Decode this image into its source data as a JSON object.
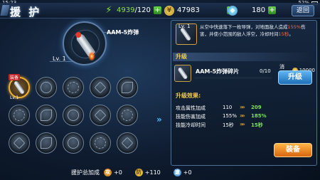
{
  "status_bar": {
    "time": "15:23",
    "battery": "52%"
  },
  "header": {
    "title": "援 护",
    "energy": {
      "current": "4939",
      "max": "/120"
    },
    "coins": "47983",
    "gems": "180",
    "return_label": "返回"
  },
  "main_skill": {
    "name": "AAM-5炸弹",
    "level": "Lv. 1"
  },
  "skill_grid": {
    "slots": [
      {
        "badge": "装备",
        "level": "Lv.1"
      }
    ]
  },
  "bottom": {
    "label": "援护总加成",
    "atk_symbol": "攻",
    "def_symbol": "防",
    "spd_symbol": "速",
    "atk_value": "+0",
    "def_value": "+110",
    "spd_value": "+0"
  },
  "detail": {
    "level": "Lv. 1",
    "desc_parts": [
      "从空中快速落下一枚导弹，对地面敌人造成",
      "155%",
      "伤害，并使小范围的敌人浮空，冷却时间",
      "15秒",
      "。"
    ]
  },
  "upgrade": {
    "section_label": "升级",
    "material_name": "AAM-5炸弹碎片",
    "material_count": "0/10",
    "material_progress": 0,
    "cost_label": "消耗:",
    "cost_value": "10000",
    "button_label": "升级"
  },
  "effect": {
    "title": "升级效果:",
    "rows": [
      {
        "label": "攻击属性加成",
        "current": "110",
        "next": "209"
      },
      {
        "label": "技能伤害加成",
        "current": "155%",
        "next": "185%"
      },
      {
        "label": "技能冷却时间",
        "current": "15秒",
        "next": "15秒"
      }
    ],
    "arrow_glyph": "»»"
  },
  "equip_button": "装备",
  "colors": {
    "accent_gold": "#f2c94c",
    "upgrade_green": "#7ee35a",
    "highlight_red": "#ff6a3d"
  },
  "icons": {
    "energy": "lightning-icon",
    "coins": "coin-icon",
    "gems": "gem-icon",
    "grid_arrow": "double-chevron-right-icon"
  }
}
